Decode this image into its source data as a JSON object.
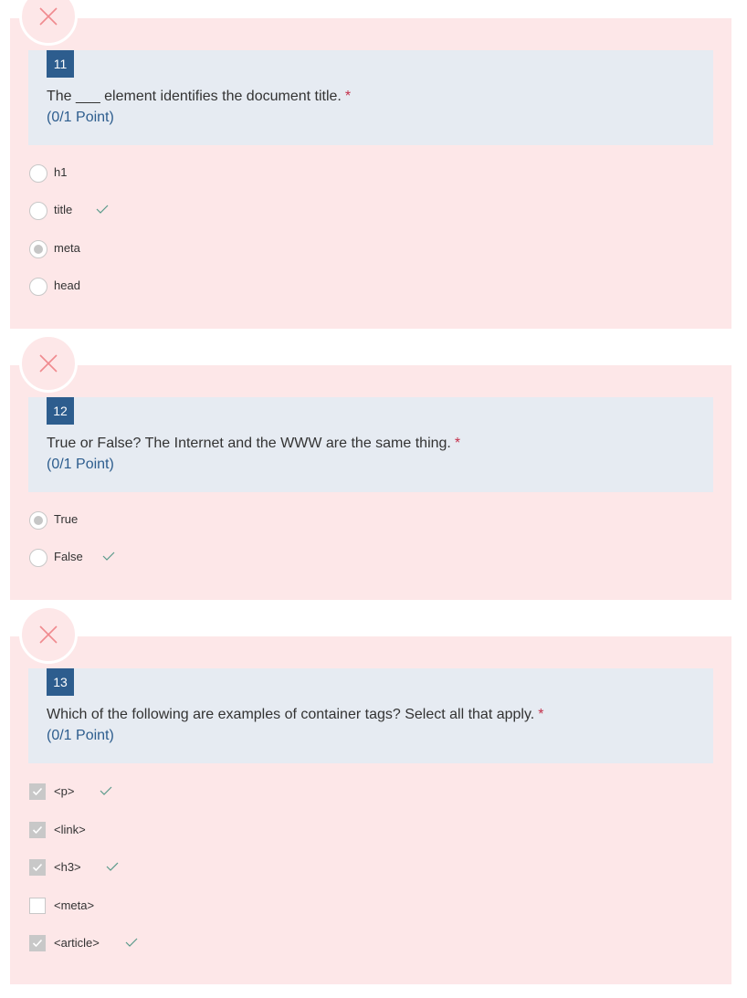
{
  "questions": [
    {
      "number": "11",
      "text": "The ___ element identifies the document title.",
      "required_mark": "*",
      "points": "(0/1 Point)",
      "result": "incorrect",
      "type": "radio",
      "options": [
        {
          "label": "h1",
          "selected": false,
          "correct": false
        },
        {
          "label": "title",
          "selected": false,
          "correct": true
        },
        {
          "label": "meta",
          "selected": true,
          "correct": false
        },
        {
          "label": "head",
          "selected": false,
          "correct": false
        }
      ]
    },
    {
      "number": "12",
      "text": "True or False? The Internet and the WWW are the same thing.",
      "required_mark": "*",
      "points": "(0/1 Point)",
      "result": "incorrect",
      "type": "radio",
      "options": [
        {
          "label": "True",
          "selected": true,
          "correct": false
        },
        {
          "label": "False",
          "selected": false,
          "correct": true
        }
      ]
    },
    {
      "number": "13",
      "text": "Which of the following are examples of container tags? Select all that apply.",
      "required_mark": "*",
      "points": "(0/1 Point)",
      "result": "incorrect",
      "type": "checkbox",
      "options": [
        {
          "label": "<p>",
          "selected": true,
          "correct": true
        },
        {
          "label": "<link>",
          "selected": true,
          "correct": false
        },
        {
          "label": "<h3>",
          "selected": true,
          "correct": true
        },
        {
          "label": "<meta>",
          "selected": false,
          "correct": false
        },
        {
          "label": "<article>",
          "selected": true,
          "correct": true
        }
      ]
    }
  ],
  "colors": {
    "card_background": "#fde7e8",
    "question_header": "#e6ebf2",
    "number_badge": "#2d5d8e",
    "required": "#c4314b",
    "incorrect_icon": "#f08a8f",
    "correct_check": "#5a9a8a"
  }
}
